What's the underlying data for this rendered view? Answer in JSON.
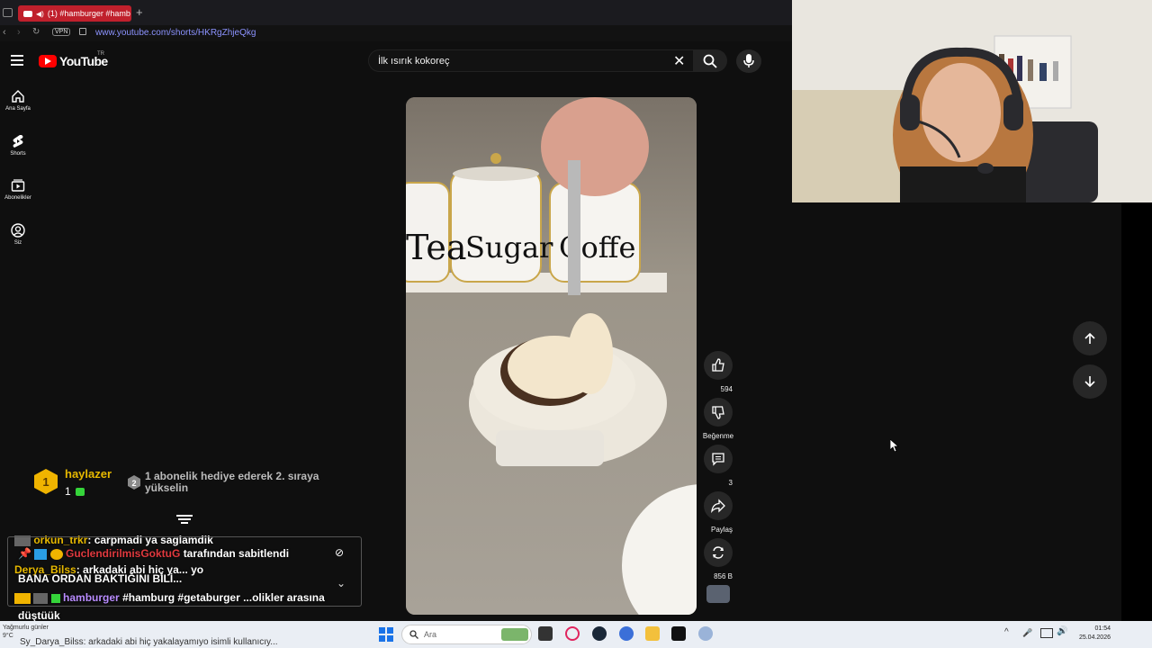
{
  "browser": {
    "tab_title": "(1) #hamburger #hamb",
    "url": "www.youtube.com/shorts/HKRgZhjeQkg",
    "vpn_label": "VPN"
  },
  "youtube": {
    "logo_text": "YouTube",
    "region": "TR",
    "search_value": "İlk ısırık kokoreç",
    "nav": [
      {
        "label": "Ana Sayfa",
        "icon": "home-icon"
      },
      {
        "label": "Shorts",
        "icon": "shorts-icon"
      },
      {
        "label": "Abonelikler",
        "icon": "subscriptions-icon"
      },
      {
        "label": "Siz",
        "icon": "you-icon"
      }
    ],
    "actions": {
      "like_count": "594",
      "dislike_label": "Beğenme",
      "comment_count": "3",
      "share_label": "Paylaş",
      "remix_count": "856 B"
    }
  },
  "stream_overlay": {
    "top_sub": {
      "rank": "1",
      "name": "haylazer",
      "count": "1"
    },
    "gift_rank": "2",
    "gift_text": "1 abonelik hediye ederek 2. sıraya yükselin",
    "chat": [
      {
        "user": "orkun_trkr",
        "text": ": carpmadi ya saglamdik"
      },
      {
        "user": "GuclendirilmisGoktuG",
        "text": "tarafından sabitlendi"
      },
      {
        "user": "Derya_Bilss",
        "text": ": arkadaki abi hiç ya... yo"
      },
      {
        "user": "",
        "text": "BANA ORDAN BAKTIĞINI BİLİ..."
      },
      {
        "user": "hamburger",
        "text": "#hamburg #getaburger ...olikler arasına"
      },
      {
        "user": "",
        "text": "düştüük"
      }
    ],
    "shadow_line": "Sy_Darya_Bilss: arkadaki abi hiç yakalayamıyo isimli kullanıcıy..."
  },
  "taskbar": {
    "weather_line1": "Yağmurlu günler",
    "weather_line2": "9°C",
    "search_placeholder": "Ara",
    "time": "01:54",
    "date": "25.04.2026"
  }
}
